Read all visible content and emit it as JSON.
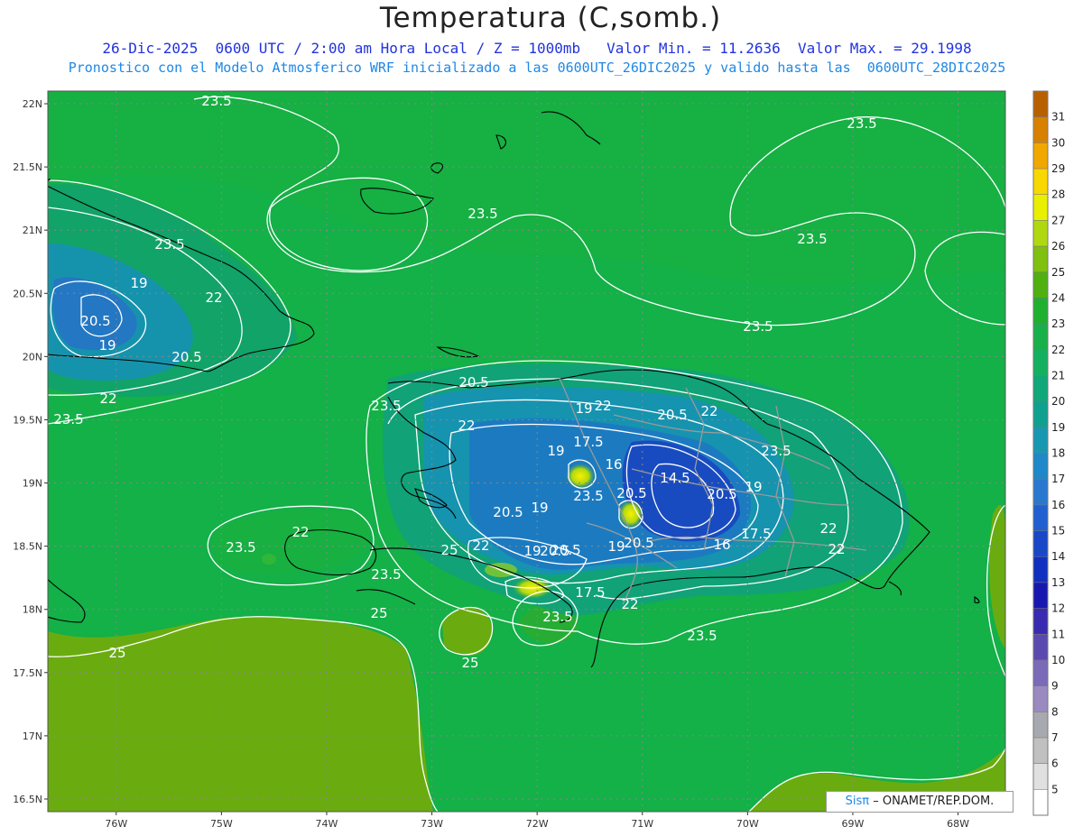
{
  "header": {
    "title": "Temperatura (C,somb.)",
    "line1": "26-Dic-2025  0600 UTC / 2:00 am Hora Local / Z = 1000mb   Valor Min. = 11.2636  Valor Max. = 29.1998",
    "line2": "Pronostico con el Modelo Atmosferico WRF inicializado a las 0600UTC_26DIC2025 y valido hasta las  0600UTC_28DIC2025"
  },
  "map": {
    "lat_labels": [
      "22N",
      "21.5N",
      "21N",
      "20.5N",
      "20N",
      "19.5N",
      "19N",
      "18.5N",
      "18N",
      "17.5N",
      "17N",
      "16.5N"
    ],
    "lon_labels": [
      "76W",
      "75W",
      "74W",
      "73W",
      "72W",
      "71W",
      "70W",
      "69W",
      "68W"
    ],
    "contour_labels": [
      "23.5",
      "23.5",
      "23.5",
      "23.5",
      "23.5",
      "23.5",
      "23.5",
      "23.5",
      "23.5",
      "23.5",
      "23.5",
      "23.5",
      "23.5",
      "19",
      "22",
      "20.5",
      "19",
      "20.5",
      "22",
      "20.5",
      "22",
      "19",
      "22",
      "17.5",
      "19",
      "20.5",
      "22",
      "16",
      "14.5",
      "20.5",
      "20.5",
      "19",
      "20.5",
      "19",
      "20.5",
      "16",
      "17.5",
      "22",
      "22",
      "22",
      "25",
      "22",
      "19",
      "20.5",
      "19",
      "20.5",
      "17.5",
      "22",
      "25",
      "25",
      "25",
      "23.5"
    ]
  },
  "colorbar": {
    "levels": [
      "5",
      "6",
      "7",
      "8",
      "9",
      "10",
      "11",
      "12",
      "13",
      "14",
      "15",
      "16",
      "17",
      "18",
      "19",
      "20",
      "21",
      "22",
      "23",
      "24",
      "25",
      "26",
      "27",
      "28",
      "29",
      "30",
      "31"
    ],
    "colors": [
      "#ffffff",
      "#e0e0e0",
      "#c0c0c0",
      "#a8a8b0",
      "#9a8ac0",
      "#7a6ab8",
      "#5a4ab0",
      "#3a2ab0",
      "#1818b0",
      "#1030c0",
      "#1848c8",
      "#2060d0",
      "#2878d0",
      "#1e88c8",
      "#1898b0",
      "#10a090",
      "#10a878",
      "#14b060",
      "#18b048",
      "#20b030",
      "#50b010",
      "#80c010",
      "#b0d810",
      "#e8f000",
      "#f8d800",
      "#f0a800",
      "#d88000",
      "#b86000"
    ]
  },
  "credit": {
    "sis": "Sisπ",
    "rest": "– ONAMET/REP.DOM."
  }
}
